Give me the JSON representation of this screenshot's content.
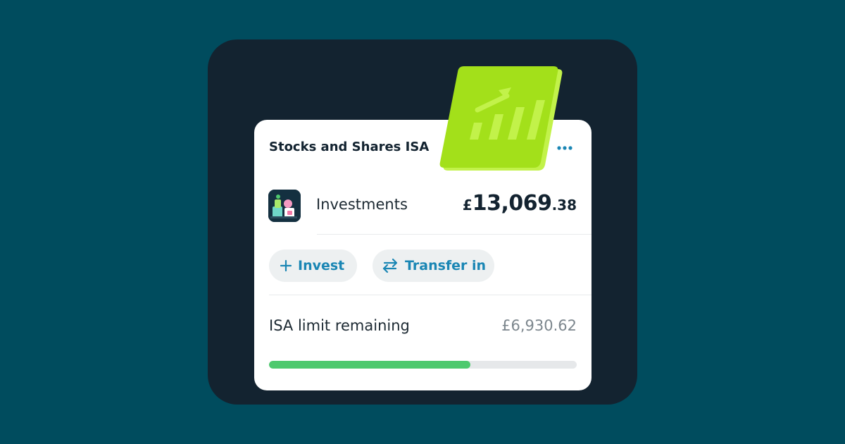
{
  "card": {
    "title": "Stocks and Shares ISA",
    "more_icon": "more-dots-icon"
  },
  "investments": {
    "label": "Investments",
    "currency_symbol": "£",
    "amount_main": "13,069",
    "amount_pence": ".38",
    "thumbnail_icon": "investments-illustration-icon"
  },
  "actions": {
    "invest_label": "Invest",
    "invest_icon": "plus-icon",
    "transfer_label": "Transfer in",
    "transfer_icon": "transfer-arrows-icon"
  },
  "isa_limit": {
    "label": "ISA limit remaining",
    "value": "£6,930.62",
    "progress_fraction": 0.6535
  },
  "badge": {
    "icon": "bar-chart-up-arrow-icon"
  },
  "colors": {
    "background": "#004c5e",
    "panel": "#132330",
    "card": "#ffffff",
    "accent_blue": "#1a86b4",
    "progress_green": "#4ec96e",
    "badge_lime": "#a3e01a",
    "badge_shadow": "#c2f24a"
  }
}
